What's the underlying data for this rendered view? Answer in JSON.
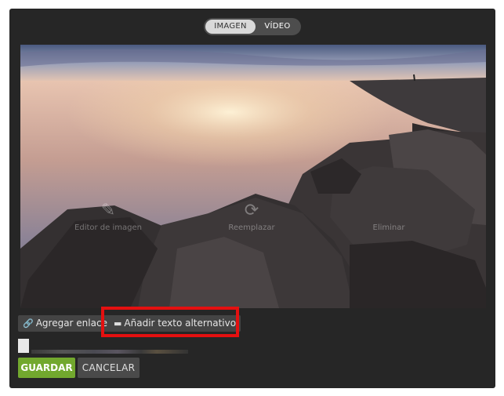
{
  "toggle": {
    "image_label": "IMAGEN",
    "video_label": "VÍDEO"
  },
  "overlay": {
    "edit_label": "Editor de imagen",
    "replace_label": "Reemplazar",
    "delete_label": "Eliminar"
  },
  "actions": {
    "add_link_label": "Agregar enlace",
    "alt_text_label": "Añadir texto alternativo"
  },
  "footer": {
    "save_label": "GUARDAR",
    "cancel_label": "CANCELAR"
  },
  "colors": {
    "save_accent": "#72a82e",
    "highlight": "#e41010",
    "panel": "#262626"
  }
}
